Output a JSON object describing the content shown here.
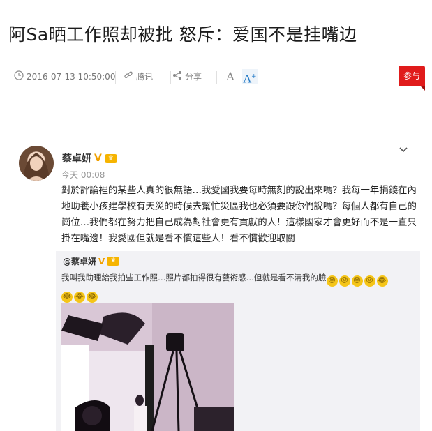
{
  "article": {
    "title": "阿Sa晒工作照却被批 怒斥：爱国不是挂嘴边"
  },
  "meta": {
    "datetime": "2016-07-13 10:50:00",
    "source": "腾讯",
    "share": "分享",
    "font_small": "A",
    "font_large": "A",
    "reply_label": "参与"
  },
  "icons": {
    "clock": "clock-icon",
    "link": "link-icon",
    "share": "share-icon",
    "expand": "chevron-down-icon"
  },
  "colors": {
    "accent_red": "#e01b1b",
    "accent_blue": "#2a7ec8",
    "repost_bg": "#f2f2f5"
  },
  "post": {
    "username": "蔡卓妍",
    "v_badge": "V",
    "time": "今天 00:08",
    "text": "對於評論裡的某些人真的很無語…我愛國我要每時無刻的說出來嗎？我每一年捐錢在內地助養小孩建學校有天災的時候去幫忙災區我也必須要跟你們說嗎？每個人都有自己的崗位…我們都在努力把自己成為對社會更有貢獻的人！這樣國家才會更好而不是一直只掛在嘴邊！我愛國但就是看不慣這些人！看不慣歡迎取關"
  },
  "repost": {
    "username": "@蔡卓妍",
    "v_badge": "V",
    "text": "我叫我助理給我拍些工作照…照片都拍得很有藝術感…但就是看不清我的臉",
    "emojis_line1": [
      "sweat-emoji",
      "sweat-emoji",
      "sweat-emoji",
      "sweat-emoji",
      "laugh-cry-emoji"
    ],
    "emojis_line2": [
      "laugh-cry-emoji",
      "laugh-cry-emoji",
      "laugh-cry-emoji"
    ]
  }
}
